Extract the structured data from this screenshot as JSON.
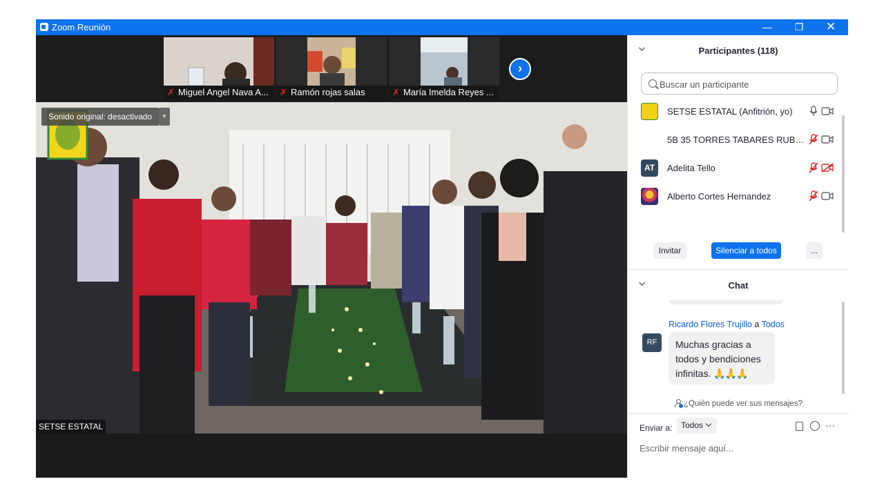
{
  "window": {
    "title": "Zoom Reunión",
    "min_glyph": "—",
    "max_glyph": "❐",
    "close_glyph": "✕"
  },
  "thumbnails": [
    {
      "name": "Miguel Angel Nava A..."
    },
    {
      "name": "Ramón rojas salas"
    },
    {
      "name": "María Imelda Reyes ..."
    }
  ],
  "main_video": {
    "audio_chip": "Sonido original: desactivado",
    "speaker_name": "SETSE ESTATAL"
  },
  "participants_panel": {
    "title": "Participantes (118)",
    "search_placeholder": "Buscar un participante",
    "participants": [
      {
        "name": "SETSE ESTATAL (Anfitrión, yo)",
        "avatar": "",
        "avatar_color": "#f1d21a",
        "mic_muted": false,
        "video_off": false
      },
      {
        "name": "5B 35 TORRES TABARES RUBEN ...",
        "avatar": "",
        "avatar_color": "#ffffff",
        "mic_muted": true,
        "video_off": false
      },
      {
        "name": "Adelita Tello",
        "avatar": "AT",
        "avatar_color": "#34495e",
        "mic_muted": true,
        "video_off": true
      },
      {
        "name": "Alberto Cortes Hernandez",
        "avatar": "",
        "avatar_color": "#6a3fa0",
        "mic_muted": true,
        "video_off": false
      }
    ],
    "buttons": {
      "invite": "Invitar",
      "mute_all": "Silenciar a todos",
      "more": "..."
    }
  },
  "chat_panel": {
    "title": "Chat",
    "messages": [
      {
        "sender": "Ricardo Flores Trujillo",
        "to_prefix": "a",
        "to": "Todos",
        "avatar": "RF",
        "text": "Muchas gracias  a todos y bendiciones infinitas.",
        "emoji": "🙏🙏🙏"
      }
    ],
    "who_sees": "¿Quién puede ver sus mensajes?",
    "send_to_label": "Enviar a:",
    "send_to_value": "Todos",
    "input_placeholder": "Escribir mensaje aquí...",
    "more": "···"
  },
  "colors": {
    "zoom_blue": "#0e72ed",
    "muted_red": "#e02828"
  }
}
